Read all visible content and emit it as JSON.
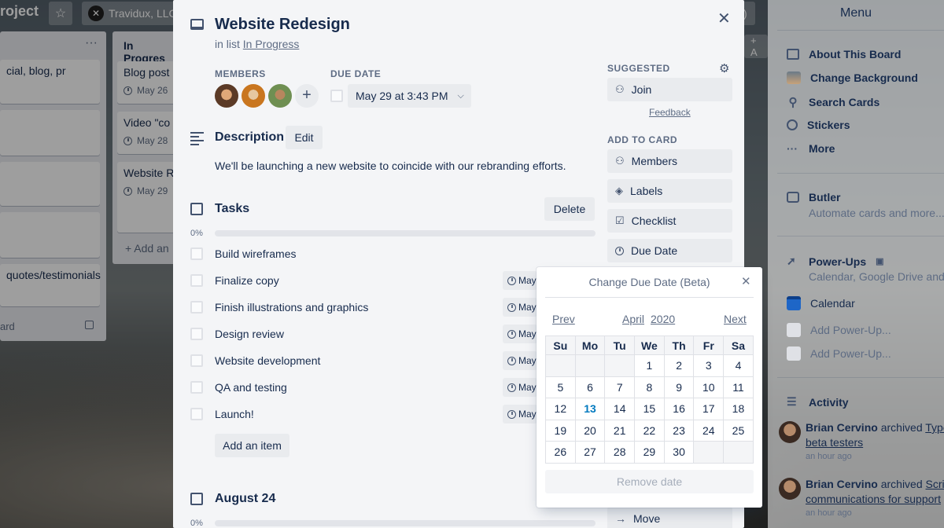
{
  "board": {
    "title": "roject",
    "team": "Travidux, LLC",
    "lists": [
      {
        "cards": [
          "cial, blog, pr",
          "",
          "",
          "",
          "quotes/testimonials"
        ],
        "footer": "ard"
      },
      {
        "name": "In Progres",
        "cards": [
          {
            "title": "Blog post",
            "date": "May 26"
          },
          {
            "title": "Video \"co",
            "date": "May 28"
          },
          {
            "title": "Website R",
            "date": "May 29"
          }
        ],
        "add_label": "+ Add an"
      }
    ],
    "add_another": "+ A"
  },
  "card": {
    "title": "Website Redesign",
    "in_list_prefix": "in list",
    "list_name": "In Progress",
    "members_label": "MEMBERS",
    "members": [
      {
        "color": "#8a5a3c"
      },
      {
        "color": "#d8893a"
      },
      {
        "color": "#7a9a5a"
      }
    ],
    "due_label": "DUE DATE",
    "due_value": "May 29 at 3:43 PM",
    "description_heading": "Description",
    "edit_label": "Edit",
    "description": "We'll be launching a new website to coincide with our rebranding efforts.",
    "checklists": [
      {
        "title": "Tasks",
        "delete_label": "Delete",
        "percent": "0%",
        "progress": 0,
        "items": [
          {
            "text": "Build wireframes",
            "badge": ""
          },
          {
            "text": "Finalize copy",
            "badge": "May"
          },
          {
            "text": "Finish illustrations and graphics",
            "badge": "May"
          },
          {
            "text": "Design review",
            "badge": "May"
          },
          {
            "text": "Website development",
            "badge": "May"
          },
          {
            "text": "QA and testing",
            "badge": "May"
          },
          {
            "text": "Launch!",
            "badge": "May"
          }
        ],
        "add_item_label": "Add an item"
      },
      {
        "title": "August 24",
        "percent": "0%",
        "progress": 0
      }
    ],
    "sidebar": {
      "suggested_label": "SUGGESTED",
      "join_label": "Join",
      "feedback_label": "Feedback",
      "add_to_card_label": "ADD TO CARD",
      "buttons": [
        "Members",
        "Labels",
        "Checklist",
        "Due Date"
      ],
      "move_label": "Move"
    }
  },
  "date_popover": {
    "title": "Change Due Date (Beta)",
    "prev": "Prev",
    "month": "April",
    "year": "2020",
    "next": "Next",
    "weekdays": [
      "Su",
      "Mo",
      "Tu",
      "We",
      "Th",
      "Fr",
      "Sa"
    ],
    "weeks": [
      [
        "",
        "",
        "",
        "1",
        "2",
        "3",
        "4"
      ],
      [
        "5",
        "6",
        "7",
        "8",
        "9",
        "10",
        "11"
      ],
      [
        "12",
        "13",
        "14",
        "15",
        "16",
        "17",
        "18"
      ],
      [
        "19",
        "20",
        "21",
        "22",
        "23",
        "24",
        "25"
      ],
      [
        "26",
        "27",
        "28",
        "29",
        "30",
        "",
        ""
      ]
    ],
    "today": "13",
    "remove_label": "Remove date"
  },
  "menu": {
    "title": "Menu",
    "items": [
      "About This Board",
      "Change Background",
      "Search Cards",
      "Stickers",
      "More"
    ],
    "butler": {
      "label": "Butler",
      "sub": "Automate cards and more..."
    },
    "powerups": {
      "label": "Power-Ups",
      "sub": "Calendar, Google Drive and m"
    },
    "calendar_label": "Calendar",
    "add_powerup": [
      "Add Power-Up...",
      "Add Power-Up..."
    ],
    "activity_label": "Activity",
    "activities": [
      {
        "user": "Brian Cervino",
        "action": "archived",
        "target": "Type",
        "target2": "beta testers",
        "time": "an hour ago"
      },
      {
        "user": "Brian Cervino",
        "action": "archived",
        "target": "Scrip",
        "target2": "communications for support",
        "time": "an hour ago"
      }
    ]
  },
  "colors": {
    "accent": "#0079bf",
    "calendar_icon": "#1e66c7"
  }
}
